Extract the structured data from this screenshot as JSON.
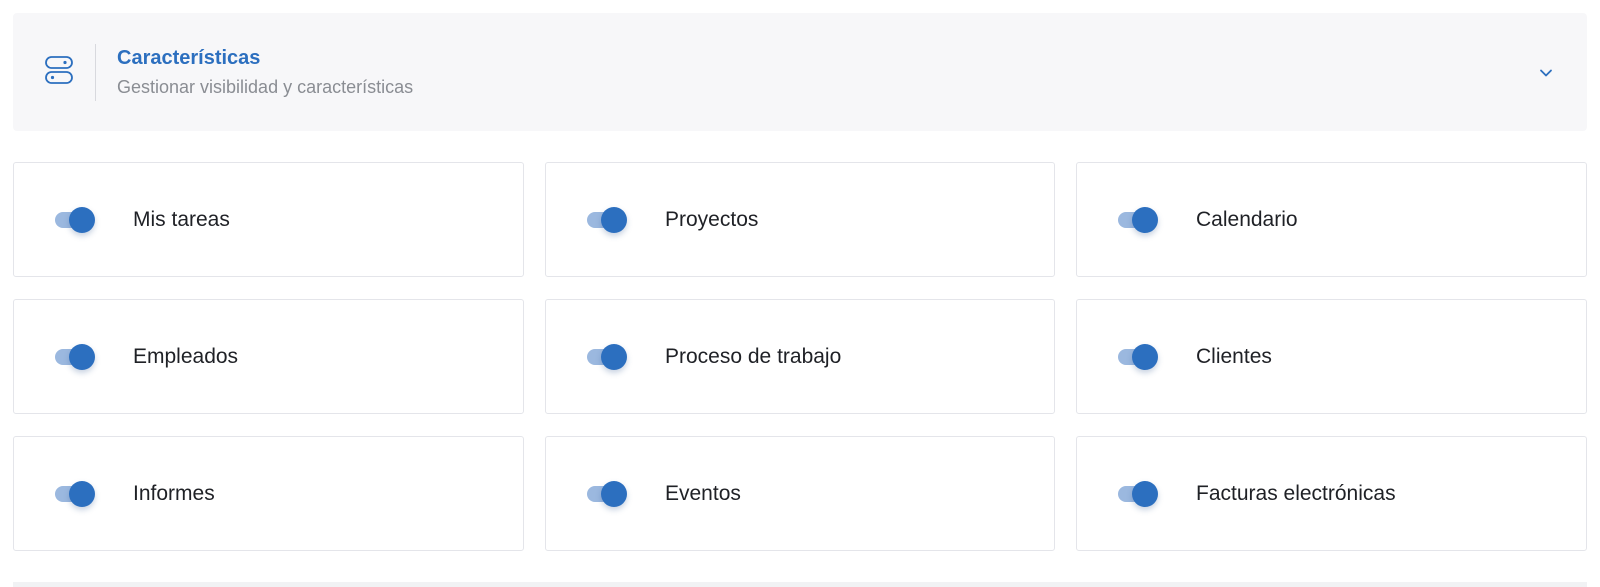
{
  "header": {
    "title": "Características",
    "subtitle": "Gestionar visibilidad y características",
    "icon": "toggles-icon",
    "expand_icon": "chevron-down-icon"
  },
  "colors": {
    "accent": "#2c6fbf",
    "track": "#9bb8df",
    "header_bg": "#f7f7f9",
    "subtitle": "#8a8d93"
  },
  "features": [
    {
      "label": "Mis tareas",
      "enabled": true
    },
    {
      "label": "Proyectos",
      "enabled": true
    },
    {
      "label": "Calendario",
      "enabled": true
    },
    {
      "label": "Empleados",
      "enabled": true
    },
    {
      "label": "Proceso de trabajo",
      "enabled": true
    },
    {
      "label": "Clientes",
      "enabled": true
    },
    {
      "label": "Informes",
      "enabled": true
    },
    {
      "label": "Eventos",
      "enabled": true
    },
    {
      "label": "Facturas electrónicas",
      "enabled": true
    }
  ]
}
